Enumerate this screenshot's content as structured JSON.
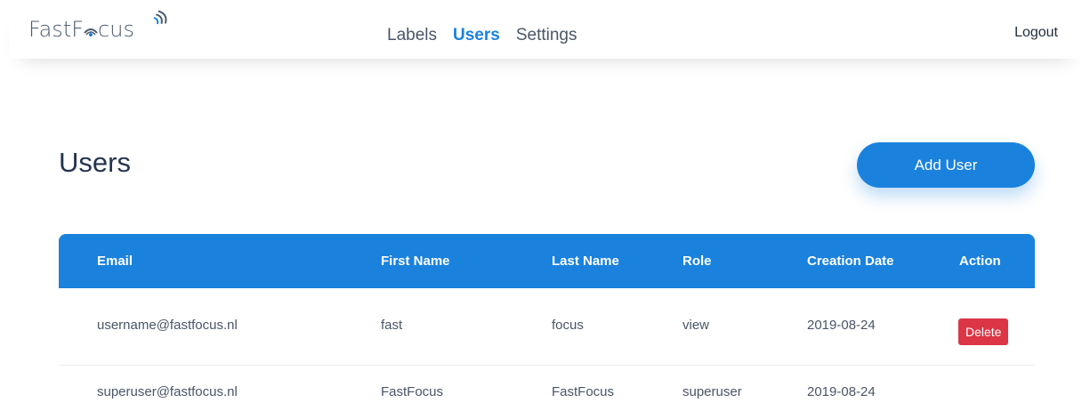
{
  "header": {
    "logo_text_a": "Fast",
    "logo_text_b": "F",
    "logo_text_c": "cus",
    "nav": [
      {
        "label": "Labels",
        "active": false
      },
      {
        "label": "Users",
        "active": true
      },
      {
        "label": "Settings",
        "active": false
      }
    ],
    "logout_label": "Logout"
  },
  "page": {
    "title": "Users",
    "add_button_label": "Add User"
  },
  "table": {
    "columns": [
      "Email",
      "First Name",
      "Last Name",
      "Role",
      "Creation Date",
      "Action"
    ],
    "rows": [
      {
        "email": "username@fastfocus.nl",
        "first_name": "fast",
        "last_name": "focus",
        "role": "view",
        "creation_date": "2019-08-24",
        "action": "Delete"
      },
      {
        "email": "superuser@fastfocus.nl",
        "first_name": "FastFocus",
        "last_name": "FastFocus",
        "role": "superuser",
        "creation_date": "2019-08-24",
        "action": ""
      }
    ]
  },
  "colors": {
    "accent": "#1a82dd",
    "danger": "#dc3545",
    "title": "#25354f"
  },
  "icons": {
    "logo_eye": "eye-icon",
    "logo_waves": "signal-waves-icon"
  }
}
